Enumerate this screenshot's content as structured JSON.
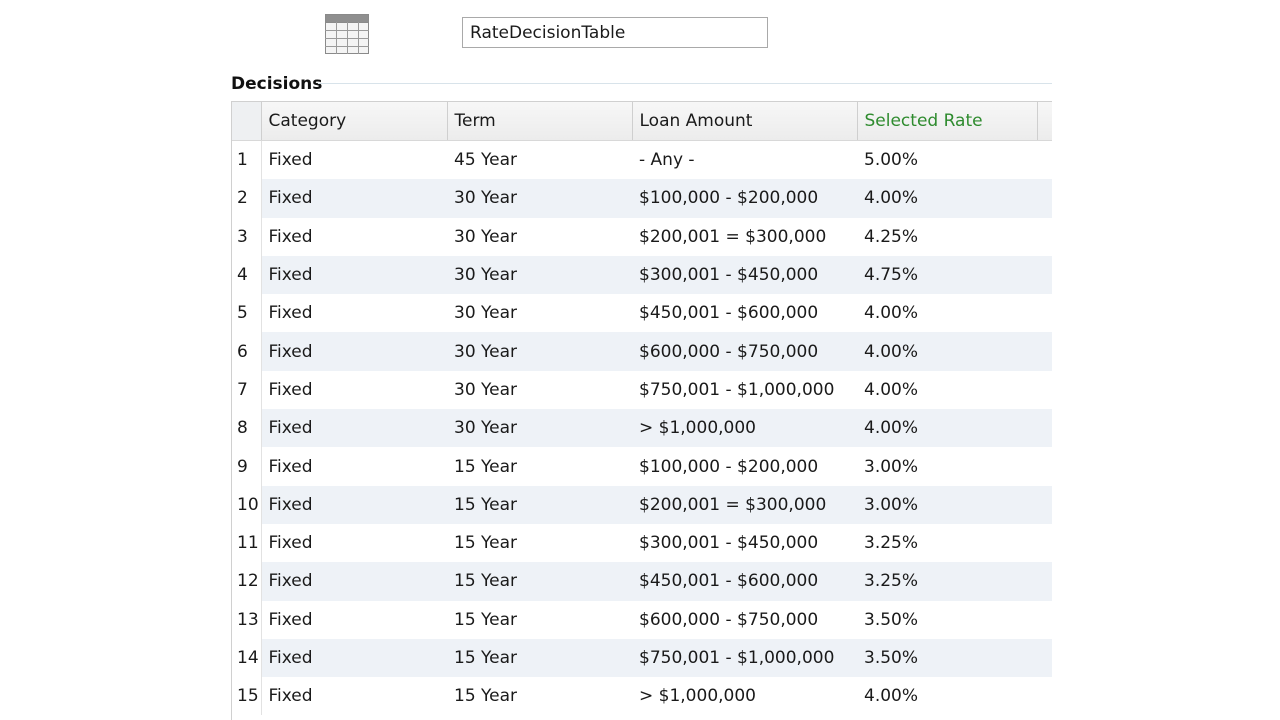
{
  "header": {
    "table_icon": "table-grid-icon",
    "table_name": "RateDecisionTable"
  },
  "section": {
    "title": "Decisions"
  },
  "decisions": {
    "columns": [
      "Category",
      "Term",
      "Loan Amount",
      "Selected Rate"
    ],
    "rate_header_color": "#2e8b2e",
    "rows": [
      {
        "num": "1",
        "category": "Fixed",
        "term": "45 Year",
        "loan_amount": " - Any -",
        "rate": "5.00%"
      },
      {
        "num": "2",
        "category": "Fixed",
        "term": "30 Year",
        "loan_amount": "$100,000 - $200,000",
        "rate": "4.00%"
      },
      {
        "num": "3",
        "category": "Fixed",
        "term": "30 Year",
        "loan_amount": "$200,001 = $300,000",
        "rate": "4.25%"
      },
      {
        "num": "4",
        "category": "Fixed",
        "term": "30 Year",
        "loan_amount": "$300,001 - $450,000",
        "rate": "4.75%"
      },
      {
        "num": "5",
        "category": "Fixed",
        "term": "30 Year",
        "loan_amount": "$450,001 - $600,000",
        "rate": "4.00%"
      },
      {
        "num": "6",
        "category": "Fixed",
        "term": "30 Year",
        "loan_amount": "$600,000 - $750,000",
        "rate": "4.00%"
      },
      {
        "num": "7",
        "category": "Fixed",
        "term": "30 Year",
        "loan_amount": "$750,001 - $1,000,000",
        "rate": "4.00%"
      },
      {
        "num": "8",
        "category": "Fixed",
        "term": "30 Year",
        "loan_amount": "> $1,000,000",
        "rate": "4.00%"
      },
      {
        "num": "9",
        "category": "Fixed",
        "term": "15 Year",
        "loan_amount": "$100,000 - $200,000",
        "rate": "3.00%"
      },
      {
        "num": "10",
        "category": "Fixed",
        "term": "15 Year",
        "loan_amount": "$200,001 = $300,000",
        "rate": "3.00%"
      },
      {
        "num": "11",
        "category": "Fixed",
        "term": "15 Year",
        "loan_amount": "$300,001 - $450,000",
        "rate": "3.25%"
      },
      {
        "num": "12",
        "category": "Fixed",
        "term": "15 Year",
        "loan_amount": "$450,001 - $600,000",
        "rate": "3.25%"
      },
      {
        "num": "13",
        "category": "Fixed",
        "term": "15 Year",
        "loan_amount": "$600,000 - $750,000",
        "rate": "3.50%"
      },
      {
        "num": "14",
        "category": "Fixed",
        "term": "15 Year",
        "loan_amount": "$750,001 - $1,000,000",
        "rate": "3.50%"
      },
      {
        "num": "15",
        "category": "Fixed",
        "term": "15 Year",
        "loan_amount": "> $1,000,000",
        "rate": "4.00%"
      }
    ]
  }
}
